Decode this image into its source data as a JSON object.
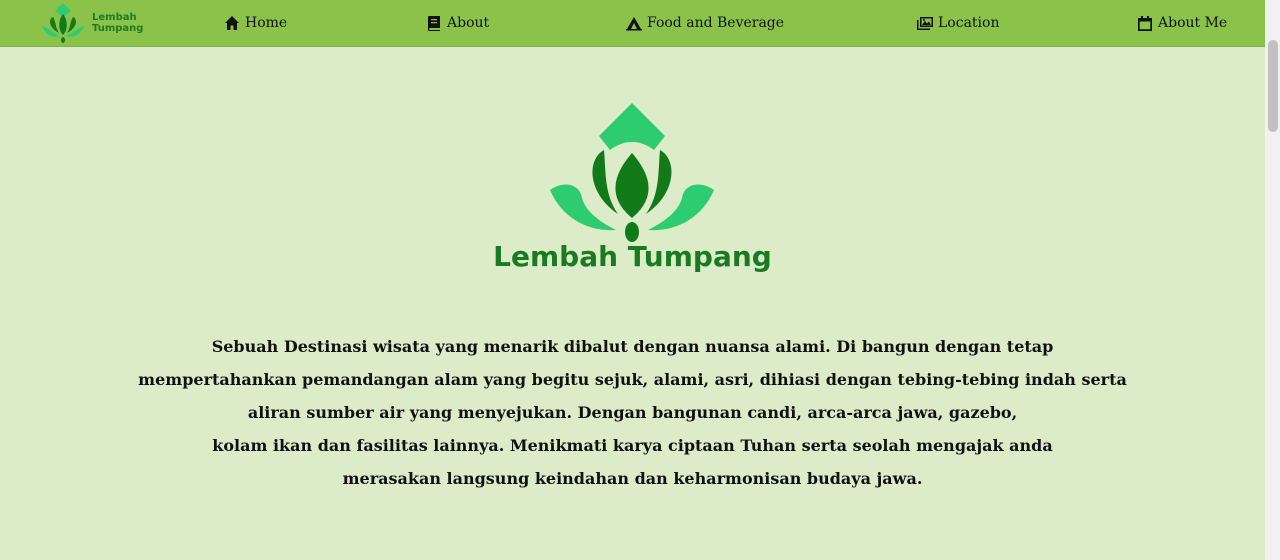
{
  "navbar": {
    "brand": {
      "line1": "Lembah",
      "line2": "Tumpang"
    },
    "items": [
      {
        "label": "Home",
        "icon": "home-icon"
      },
      {
        "label": "About",
        "icon": "book-icon"
      },
      {
        "label": "Food and Beverage",
        "icon": "campground-icon"
      },
      {
        "label": "Location",
        "icon": "images-icon"
      },
      {
        "label": "About Me",
        "icon": "calendar-icon"
      }
    ]
  },
  "hero": {
    "title": "Lembah Tumpang",
    "description": [
      "Sebuah Destinasi wisata yang menarik dibalut dengan nuansa alami. Di bangun dengan tetap",
      "mempertahankan pemandangan alam yang begitu sejuk, alami, asri, dihiasi dengan tebing-tebing indah serta",
      "aliran sumber air yang menyejukan. Dengan bangunan candi, arca-arca jawa, gazebo,",
      "kolam ikan dan fasilitas lainnya. Menikmati karya ciptaan Tuhan serta seolah mengajak anda",
      "merasakan langsung keindahan dan keharmonisan budaya jawa."
    ]
  },
  "colors": {
    "navbar": "#8bc34a",
    "background": "#ddecc8",
    "logo_dark_green": "#1a7a1f",
    "logo_light_green": "#2ecc71"
  }
}
